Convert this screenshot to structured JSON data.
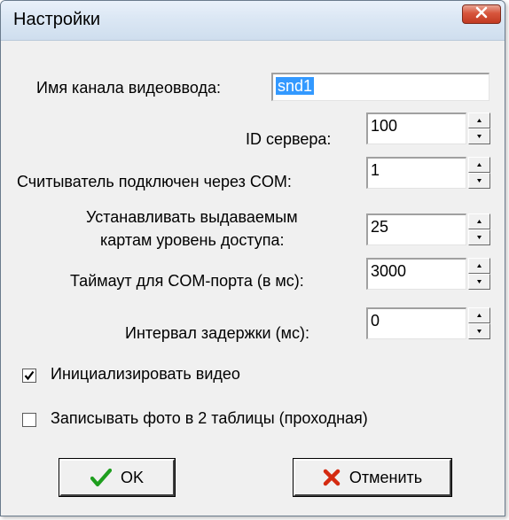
{
  "window": {
    "title": "Настройки",
    "close_icon": "close-icon"
  },
  "form": {
    "channel_name": {
      "label": "Имя канала видеоввода:",
      "value": "snd1"
    },
    "server_id": {
      "label": "ID сервера:",
      "value": "100"
    },
    "reader_com": {
      "label": "Считыватель подключен через COM:",
      "value": "1"
    },
    "access_level": {
      "label_line1": "Устанавливать выдаваемым",
      "label_line2": "картам уровень доступа:",
      "value": "25"
    },
    "com_timeout": {
      "label": "Таймаут для COM-порта (в мс):",
      "value": "3000"
    },
    "delay_interval": {
      "label": "Интервал задержки (мс):",
      "value": "0"
    },
    "init_video": {
      "label": "Инициализировать видео",
      "checked": true
    },
    "write_photo": {
      "label": "Записывать фото в 2 таблицы  (проходная)",
      "checked": false
    }
  },
  "buttons": {
    "ok": {
      "label": "OK",
      "icon": "checkmark-icon",
      "color": "#1e9e1e"
    },
    "cancel": {
      "label": "Отменить",
      "icon": "red-x-icon",
      "color": "#d42a10"
    }
  }
}
